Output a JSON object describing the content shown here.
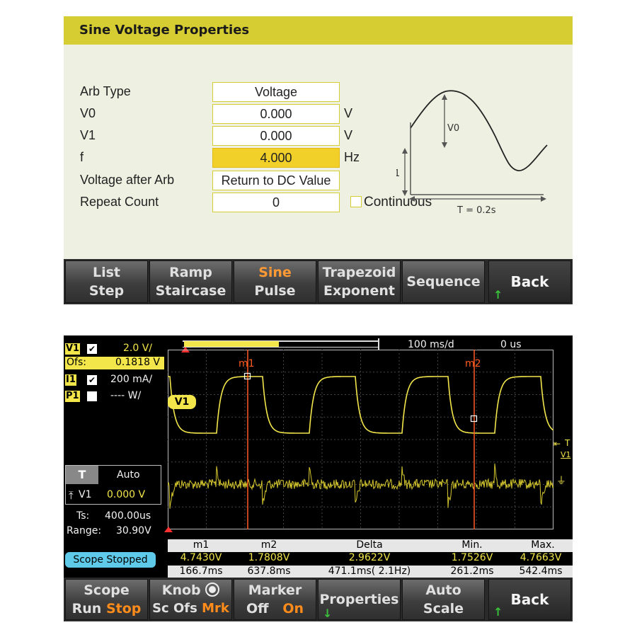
{
  "props": {
    "title": "Sine Voltage Properties",
    "rows": [
      {
        "label": "Arb Type",
        "value": "Voltage",
        "unit": ""
      },
      {
        "label": "V0",
        "value": "0.000",
        "unit": "V"
      },
      {
        "label": "V1",
        "value": "0.000",
        "unit": "V"
      },
      {
        "label": "f",
        "value": "4.000",
        "unit": "Hz"
      },
      {
        "label": "Voltage after Arb",
        "value": "Return to DC Value",
        "unit": ""
      },
      {
        "label": "Repeat Count",
        "value": "0",
        "unit": ""
      }
    ],
    "continuous_label": "Continuous",
    "continuous_checked": false,
    "diagram": {
      "v0_label": "V0",
      "v1_label": "V1",
      "period_label": "T = 0.2s"
    }
  },
  "top_softkeys": [
    {
      "line1": "List",
      "line2": "Step"
    },
    {
      "line1": "Ramp",
      "line2": "Staircase"
    },
    {
      "line1": "Sine",
      "line2": "Pulse",
      "active": true
    },
    {
      "line1": "Trapezoid",
      "line2": "Exponent"
    },
    {
      "line1": "Sequence",
      "line2": ""
    },
    {
      "line1": "Back",
      "line2": ""
    }
  ],
  "scope": {
    "timebase": "100 ms/d",
    "delay": "0 us",
    "channels": {
      "v1": {
        "tag": "V1",
        "checked": true,
        "scale": "2.0 V/",
        "offset_label": "Ofs:",
        "offset": "0.1818 V"
      },
      "i1": {
        "tag": "I1",
        "checked": true,
        "scale": "200 mA/"
      },
      "p1": {
        "tag": "P1",
        "checked": false,
        "scale": "---- W/"
      }
    },
    "trace_tag": "V1",
    "trigger": {
      "label": "T",
      "mode": "Auto",
      "source": "V1",
      "level": "0.000 V"
    },
    "ts_label": "Ts:",
    "ts_value": "400.00us",
    "range_label": "Range:",
    "range_value": "30.90V",
    "status": "Scope Stopped",
    "markers": {
      "m1": "m1",
      "m2": "m2"
    },
    "measurements": {
      "headers": [
        "m1",
        "m2",
        "Delta",
        "Min.",
        "Max."
      ],
      "voltage": [
        "4.7430V",
        "1.7808V",
        "2.9622V",
        "1.7526V",
        "4.7663V"
      ],
      "time": [
        "166.7ms",
        "637.8ms",
        "471.1ms( 2.1Hz)",
        "261.2ms",
        "542.4ms"
      ]
    },
    "right_markers": {
      "t_label": "T",
      "v1_label": "V1"
    }
  },
  "bottom_softkeys": {
    "scope": {
      "line1": "Scope",
      "a": "Run",
      "b": "Stop"
    },
    "knob": {
      "line1": "Knob",
      "a": "Sc",
      "b": "Ofs",
      "c": "Mrk"
    },
    "marker": {
      "line1": "Marker",
      "a": "Off",
      "b": "On"
    },
    "properties": {
      "line1": "Properties"
    },
    "autoscale": {
      "line1": "Auto",
      "line2": "Scale"
    },
    "back": {
      "line1": "Back"
    }
  },
  "colors": {
    "title_bar": "#d6cd32",
    "panel_bg": "#eef0e2",
    "selected_field": "#f2d02a",
    "trace_v": "#f2e64a",
    "trace_i": "#d8c830",
    "marker_line": "#ff5a1f",
    "status_badge": "#5ec9e8",
    "active_key": "#ff8c1a"
  }
}
